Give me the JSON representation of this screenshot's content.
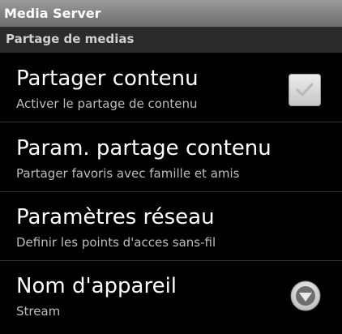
{
  "app": {
    "title": "Media Server"
  },
  "category": {
    "label": "Partage de medias"
  },
  "preferences": [
    {
      "title": "Partager contenu",
      "summary": "Activer le partage de contenu",
      "widget": "checkbox",
      "checked": true
    },
    {
      "title": "Param. partage contenu",
      "summary": "Partager favoris avec famille et amis",
      "widget": "none"
    },
    {
      "title": "Paramètres réseau",
      "summary": "Definir les points d'acces sans-fil",
      "widget": "none"
    },
    {
      "title": "Nom d'appareil",
      "summary": "Stream",
      "widget": "dropdown",
      "icon": "chevron-down-icon"
    }
  ],
  "colors": {
    "background": "#000000",
    "titlebar": "#858585",
    "category_bar": "#2b2b2b",
    "summary_text": "#bdbdbd"
  }
}
